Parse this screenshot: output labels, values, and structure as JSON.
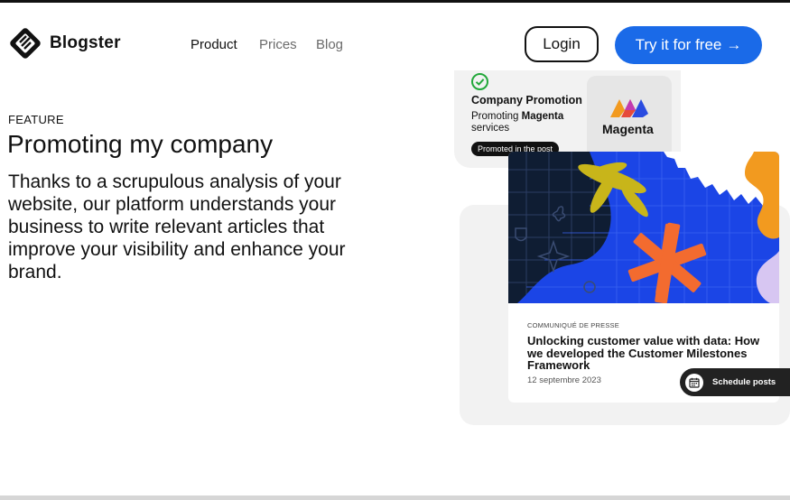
{
  "header": {
    "brand": "Blogster",
    "nav": [
      {
        "label": "Product"
      },
      {
        "label": "Prices"
      },
      {
        "label": "Blog"
      }
    ],
    "login_label": "Login",
    "cta_label": "Try it for free",
    "cta_arrow": "→"
  },
  "hero": {
    "eyebrow": "FEATURE",
    "headline": "Promoting my company",
    "body": "Thanks to a scrupulous analysis of your website, our platform understands your business to write relevant articles that improve your visibility and enhance your brand."
  },
  "promo_card": {
    "title": "Company Promotion",
    "subtitle_prefix": "Promoting",
    "subtitle_brand": "Magenta",
    "subtitle_suffix": "services",
    "chip": "Promoted in the post",
    "logo_word": "Magenta"
  },
  "article": {
    "kicker": "COMMUNIQUÉ DE PRESSE",
    "title": "Unlocking customer value with data: How we developed the Customer Milestones Framework",
    "date": "12 septembre 2023"
  },
  "schedule": {
    "label": "Schedule posts"
  },
  "colors": {
    "accent": "#1a6ae8",
    "check": "#22a83a",
    "art_blue": "#1b45e6",
    "art_orange": "#f36b2f",
    "art_yellow": "#c8b51a",
    "art_navy": "#0f1d33"
  },
  "icons": [
    "blogster-logo-icon",
    "check-circle-icon",
    "magenta-logo-icon",
    "calendar-icon",
    "arrow-right-icon"
  ]
}
